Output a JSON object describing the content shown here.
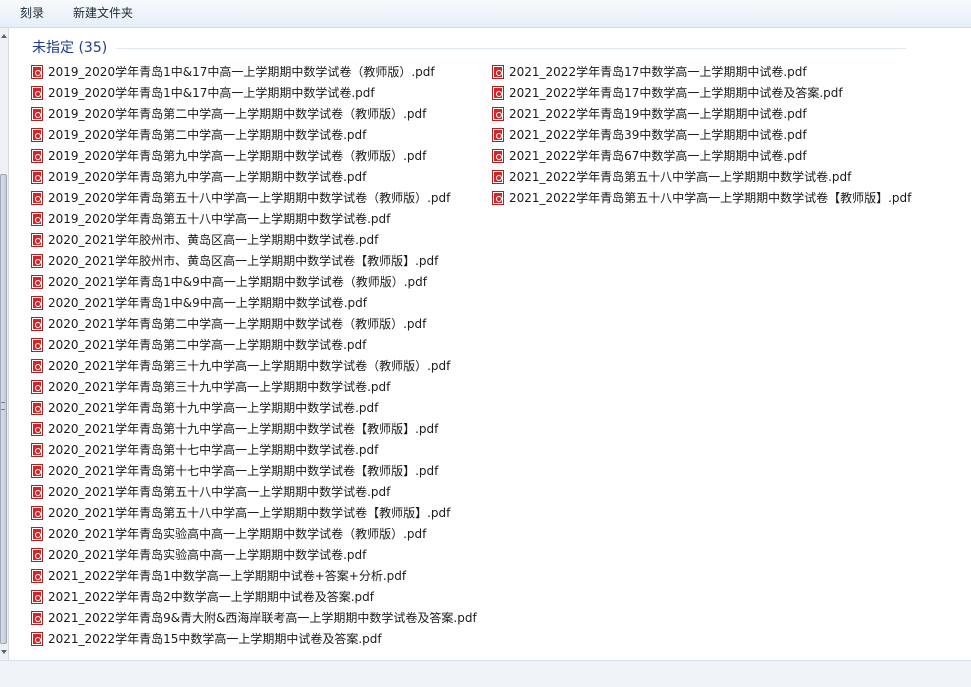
{
  "toolbar": {
    "burn_label": "刻录",
    "new_folder_label": "新建文件夹"
  },
  "group": {
    "title": "未指定 (35)"
  },
  "files_left": [
    "2019_2020学年青岛1中&17中高一上学期期中数学试卷（教师版）.pdf",
    "2019_2020学年青岛1中&17中高一上学期期中数学试卷.pdf",
    "2019_2020学年青岛第二中学高一上学期期中数学试卷（教师版）.pdf",
    "2019_2020学年青岛第二中学高一上学期期中数学试卷.pdf",
    "2019_2020学年青岛第九中学高一上学期期中数学试卷（教师版）.pdf",
    "2019_2020学年青岛第九中学高一上学期期中数学试卷.pdf",
    "2019_2020学年青岛第五十八中学高一上学期期中数学试卷（教师版）.pdf",
    "2019_2020学年青岛第五十八中学高一上学期期中数学试卷.pdf",
    "2020_2021学年胶州市、黄岛区高一上学期期中数学试卷.pdf",
    "2020_2021学年胶州市、黄岛区高一上学期期中数学试卷【教师版】.pdf",
    "2020_2021学年青岛1中&9中高一上学期期中数学试卷（教师版）.pdf",
    "2020_2021学年青岛1中&9中高一上学期期中数学试卷.pdf",
    "2020_2021学年青岛第二中学高一上学期期中数学试卷（教师版）.pdf",
    "2020_2021学年青岛第二中学高一上学期期中数学试卷.pdf",
    "2020_2021学年青岛第三十九中学高一上学期期中数学试卷（教师版）.pdf",
    "2020_2021学年青岛第三十九中学高一上学期期中数学试卷.pdf",
    "2020_2021学年青岛第十九中学高一上学期期中数学试卷.pdf",
    "2020_2021学年青岛第十九中学高一上学期期中数学试卷【教师版】.pdf",
    "2020_2021学年青岛第十七中学高一上学期期中数学试卷.pdf",
    "2020_2021学年青岛第十七中学高一上学期期中数学试卷【教师版】.pdf",
    "2020_2021学年青岛第五十八中学高一上学期期中数学试卷.pdf",
    "2020_2021学年青岛第五十八中学高一上学期期中数学试卷【教师版】.pdf",
    "2020_2021学年青岛实验高中高一上学期期中数学试卷（教师版）.pdf",
    "2020_2021学年青岛实验高中高一上学期期中数学试卷.pdf",
    "2021_2022学年青岛1中数学高一上学期期中试卷+答案+分析.pdf",
    "2021_2022学年青岛2中数学高一上学期期中试卷及答案.pdf",
    "2021_2022学年青岛9&青大附&西海岸联考高一上学期期中数学试卷及答案.pdf",
    "2021_2022学年青岛15中数学高一上学期期中试卷及答案.pdf"
  ],
  "files_right": [
    "2021_2022学年青岛17中数学高一上学期期中试卷.pdf",
    "2021_2022学年青岛17中数学高一上学期期中试卷及答案.pdf",
    "2021_2022学年青岛19中数学高一上学期期中试卷.pdf",
    "2021_2022学年青岛39中数学高一上学期期中试卷.pdf",
    "2021_2022学年青岛67中数学高一上学期期中试卷.pdf",
    "2021_2022学年青岛第五十八中学高一上学期期中数学试卷.pdf",
    "2021_2022学年青岛第五十八中学高一上学期期中数学试卷【教师版】.pdf"
  ],
  "icons": {
    "file": "pdf-file-icon",
    "scroll_up": "scroll-up-arrow-icon",
    "scroll_down": "scroll-down-arrow-icon"
  },
  "colors": {
    "group_header": "#1e3c8c",
    "pdf_icon": "#d42626"
  }
}
